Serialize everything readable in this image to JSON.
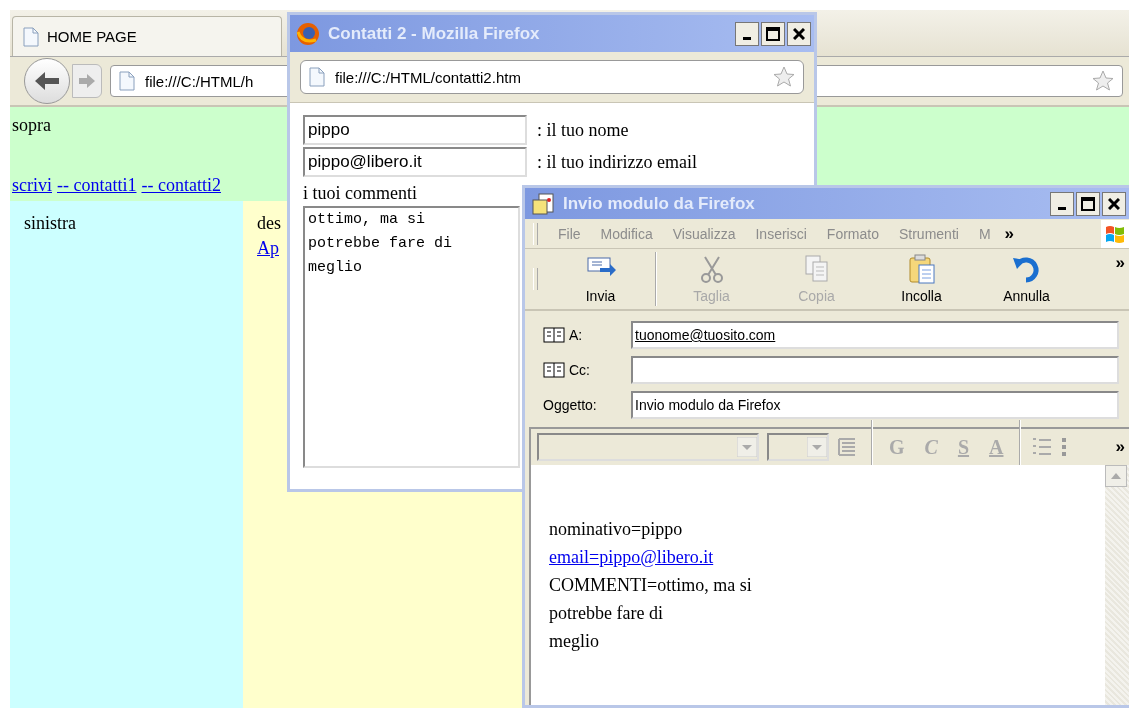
{
  "browser": {
    "tab": {
      "title": "HOME PAGE",
      "selected": true
    },
    "address": "file:///C:/HTML/h",
    "page": {
      "top_text": "sopra",
      "links": [
        "scrivi",
        "-- contatti1",
        "-- contatti2"
      ],
      "left_text": "sinistra",
      "right_text": "des",
      "right_link": "Ap"
    }
  },
  "popup": {
    "title": "Contatti 2 - Mozilla Firefox",
    "address": "file:///C:/HTML/contatti2.htm",
    "fields": [
      {
        "value": "pippo",
        "label": ": il tuo nome"
      },
      {
        "value": "pippo@libero.it",
        "label": ": il tuo indirizzo email"
      }
    ],
    "comments_label": "i tuoi commenti",
    "comments": "ottimo, ma si\npotrebbe fare di\nmeglio"
  },
  "mail": {
    "title": "Invio modulo da Firefox",
    "menu": [
      "File",
      "Modifica",
      "Visualizza",
      "Inserisci",
      "Formato",
      "Strumenti",
      "M"
    ],
    "menu_more": "»",
    "toolbar": [
      {
        "label": "Invia",
        "kind": "send",
        "disabled": false
      },
      {
        "label": "Taglia",
        "kind": "cut",
        "disabled": true
      },
      {
        "label": "Copia",
        "kind": "copy",
        "disabled": true
      },
      {
        "label": "Incolla",
        "kind": "paste",
        "disabled": false
      },
      {
        "label": "Annulla",
        "kind": "undo",
        "disabled": false
      }
    ],
    "toolbar_more": "»",
    "header": [
      {
        "label": "A:",
        "value": "tuonome@tuosito.com",
        "book": true
      },
      {
        "label": "Cc:",
        "book": true
      },
      {
        "label": "Oggetto:",
        "value": "Invio modulo da Firefox",
        "book": false
      }
    ],
    "format": [
      "G",
      "C",
      "S",
      "A"
    ],
    "format_more": "»",
    "body": [
      {
        "text": "nominativo=pippo",
        "link": false
      },
      {
        "text": "email=pippo@libero.it",
        "link": true
      },
      {
        "text": "COMMENTI=ottimo, ma si",
        "link": false
      },
      {
        "text": "potrebbe fare di",
        "link": false
      },
      {
        "text": "meglio",
        "link": false
      }
    ]
  }
}
